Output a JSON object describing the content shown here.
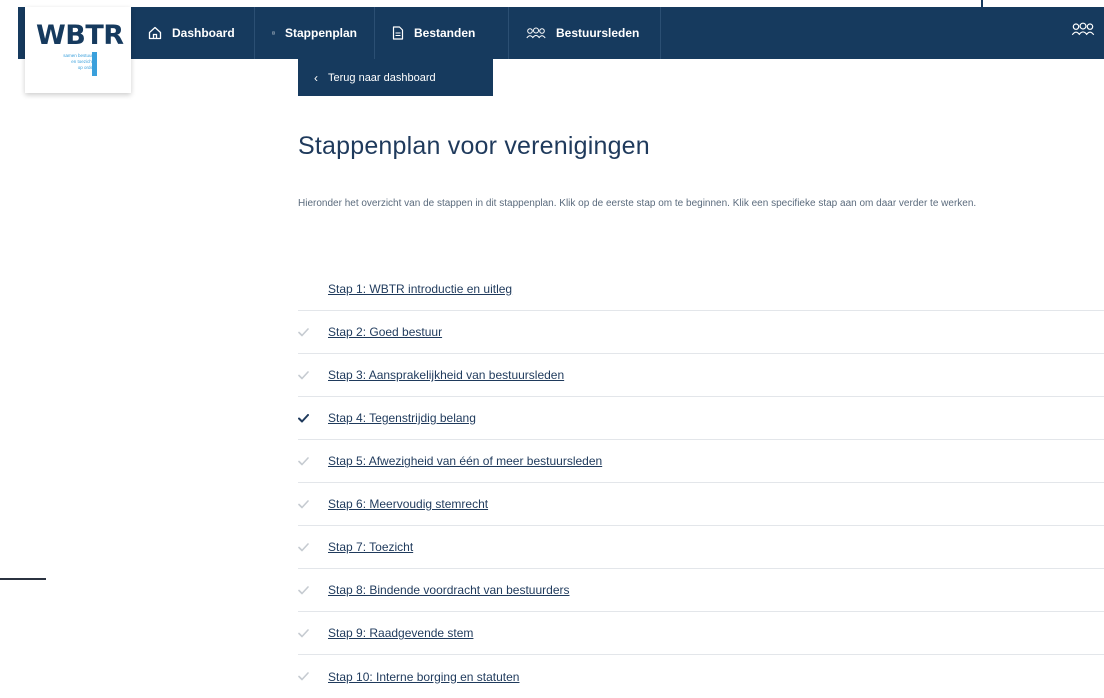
{
  "logo": {
    "name": "WBTR",
    "tagline": [
      "samen bestuur",
      "en toezicht",
      "op orde"
    ]
  },
  "nav": [
    {
      "label": "Dashboard",
      "icon": "home-icon"
    },
    {
      "label": "Stappenplan",
      "icon": "checklist-icon"
    },
    {
      "label": "Bestanden",
      "icon": "file-icon"
    },
    {
      "label": "Bestuursleden",
      "icon": "users-icon"
    }
  ],
  "back_button": {
    "label": "Terug naar dashboard",
    "icon": "chevron-left-icon"
  },
  "page": {
    "title": "Stappenplan voor verenigingen",
    "intro": "Hieronder het overzicht van de stappen in dit stappenplan. Klik op de eerste stap om te beginnen. Klik een specifieke stap aan om daar verder te werken."
  },
  "steps": [
    {
      "label": "Stap 1: WBTR introductie en uitleg",
      "status": "none"
    },
    {
      "label": "Stap 2: Goed bestuur",
      "status": "done"
    },
    {
      "label": "Stap 3: Aansprakelijkheid van bestuursleden",
      "status": "done"
    },
    {
      "label": "Stap 4: Tegenstrijdig belang",
      "status": "current"
    },
    {
      "label": "Stap 5: Afwezigheid van één of meer bestuursleden",
      "status": "done"
    },
    {
      "label": "Stap 6: Meervoudig stemrecht",
      "status": "done"
    },
    {
      "label": "Stap 7: Toezicht",
      "status": "done"
    },
    {
      "label": "Stap 8: Bindende voordracht van bestuurders",
      "status": "done"
    },
    {
      "label": "Stap 9: Raadgevende stem",
      "status": "done"
    },
    {
      "label": "Stap 10: Interne borging en statuten",
      "status": "done"
    }
  ],
  "colors": {
    "navy": "#163a5e",
    "accent_blue": "#3aa0dc",
    "check_done": "#c6cbd1",
    "check_current": "#1f3a5c"
  }
}
